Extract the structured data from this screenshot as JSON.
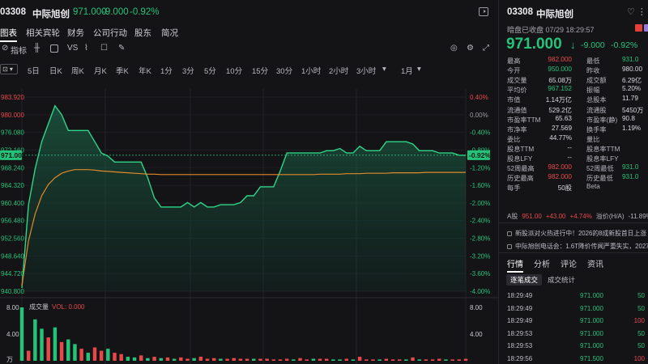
{
  "header": {
    "code": "03308",
    "name": "中际旭创",
    "price": "971.000",
    "change": "-9.000",
    "pct": "-0.92%"
  },
  "tabs": [
    "图表",
    "相关宾轮",
    "财务",
    "公司行动",
    "股东",
    "简况"
  ],
  "toolbar": {
    "indicator_label": "指标",
    "vs_label": "VS"
  },
  "periods": [
    "5日",
    "日K",
    "周K",
    "月K",
    "季K",
    "年K",
    "1分",
    "3分",
    "5分",
    "10分",
    "15分",
    "30分",
    "1小时",
    "2小时",
    "3小时",
    "1月"
  ],
  "chart_data": {
    "type": "line",
    "title": "",
    "price_axis": [
      "983.920",
      "980.000",
      "976.080",
      "972.160",
      "968.240",
      "964.320",
      "960.400",
      "956.480",
      "952.560",
      "948.640",
      "944.720",
      "940.800"
    ],
    "pct_axis": [
      "0.40%",
      "0.00%",
      "-0.40%",
      "-0.80%",
      "-1.20%",
      "-1.60%",
      "-2.00%",
      "-2.40%",
      "-2.80%",
      "-3.20%",
      "-3.60%",
      "-4.00%"
    ],
    "last_price_tag": "971.000",
    "last_pct_tag": "-0.92%",
    "price_series": [
      941.5,
      960,
      968,
      974,
      978,
      982,
      980,
      976.5,
      976.5,
      976.5,
      976.5,
      974,
      971.5,
      970.8,
      969.5,
      969.5,
      969.5,
      969.5,
      969.5,
      966,
      961.5,
      959.5,
      959.5,
      959.5,
      959.5,
      960.5,
      959.5,
      960.5,
      959.5,
      959.5,
      960,
      960,
      960,
      960.5,
      962,
      962,
      964,
      964,
      964,
      967.5,
      971.5,
      971.5,
      971.5,
      971.5,
      971.5,
      971.5,
      972,
      972,
      972.5,
      971.5,
      971.5,
      973,
      972,
      972,
      972,
      974,
      974,
      974,
      974,
      973.5,
      972,
      972,
      972,
      971.5,
      971.5,
      971.5,
      971,
      971
    ],
    "avg_series": [
      942,
      952,
      958,
      962,
      964.5,
      966,
      967,
      967.5,
      967.8,
      967.8,
      967.8,
      967.7,
      967.5,
      967.4,
      967.3,
      967.2,
      967.1,
      967,
      966.9,
      966.8,
      966.8,
      966.7,
      966.7,
      966.7,
      966.7,
      966.7,
      966.7,
      966.7,
      966.7,
      966.7,
      966.7,
      966.7,
      966.7,
      966.7,
      966.7,
      966.7,
      966.7,
      966.7,
      966.7,
      966.7,
      966.7,
      966.7,
      966.7,
      966.7,
      966.7,
      966.8,
      966.8,
      966.8,
      966.8,
      966.9,
      966.9,
      966.9,
      967,
      967,
      967,
      967,
      967.1,
      967.1,
      967.1,
      967.1,
      967.1,
      967.2,
      967.2,
      967.2,
      967.2,
      967.2,
      967.2,
      967.2
    ],
    "ylim": [
      940.8,
      983.92
    ],
    "volume_label": "成交量",
    "vol_value_label": "VOL: 0.000",
    "vol_axis_left": [
      "8.00",
      "4.00",
      "万"
    ],
    "vol_axis_right": [
      "8.00",
      "4.00"
    ],
    "volume": [
      8.0,
      1.5,
      6.2,
      4.8,
      3.5,
      5.0,
      2.8,
      3.2,
      2.5,
      1.8,
      1.2,
      2.0,
      1.5,
      1.8,
      1.2,
      1.0,
      0.6,
      0.5,
      0.8,
      0.4,
      0.6,
      0.4,
      0.5,
      0.3,
      0.5,
      0.3,
      0.4,
      0.6,
      0.3,
      0.4,
      0.3,
      0.3,
      0.4,
      0.3,
      0.3,
      0.3,
      0.3,
      0.3,
      0.2,
      0.2,
      0.3,
      0.2,
      0.4,
      0.2,
      0.3,
      0.3,
      0.3,
      0.2,
      0.2,
      0.3,
      0.2,
      0.6,
      0.2,
      0.2,
      0.2,
      0.3,
      0.2,
      0.2,
      0.2,
      0.5,
      0.2,
      0.2,
      0.2,
      0.3,
      0.2,
      0.2,
      0.2,
      0.3
    ],
    "volume_up": [
      false,
      true,
      false,
      false,
      true,
      false,
      true,
      false,
      false,
      true,
      false,
      true,
      true,
      false,
      true,
      true,
      false,
      false,
      true,
      false,
      true,
      false,
      true,
      false,
      true,
      true,
      false,
      true,
      true,
      true,
      false,
      true,
      true,
      true,
      true,
      false,
      true,
      true,
      true,
      true,
      true,
      false,
      true,
      true,
      false,
      true,
      true,
      false,
      false,
      true,
      false,
      true,
      true,
      true,
      false,
      true,
      true,
      true,
      false,
      true,
      false,
      true,
      true,
      true,
      false,
      true,
      true,
      true
    ]
  },
  "quote": {
    "code": "03308",
    "name": "中际旭创",
    "status": "暗盘已收盘 07/29 18:29:57",
    "price": "971.000",
    "change": "-9.000",
    "pct": "-0.92%",
    "rows": [
      [
        "最高",
        "982.000",
        "最低",
        "931.0"
      ],
      [
        "今开",
        "950.000",
        "昨收",
        "980.00"
      ],
      [
        "成交量",
        "65.08万",
        "成交额",
        "6.29亿"
      ],
      [
        "平均价",
        "967.152",
        "振幅",
        "5.20%"
      ],
      [
        "市值",
        "1.14万亿",
        "总股本",
        "11.79"
      ],
      [
        "流通值",
        "529.2亿",
        "流通股",
        "5450万"
      ],
      [
        "市盈率TTM",
        "65.63",
        "市盈率(静)",
        "90.8"
      ],
      [
        "市净率",
        "27.569",
        "换手率",
        "1.19%"
      ],
      [
        "委比",
        "44.77%",
        "量比",
        ""
      ],
      [
        "股息TTM",
        "--",
        "股息率TTM",
        ""
      ],
      [
        "股息LFY",
        "--",
        "股息率LFY",
        ""
      ],
      [
        "52周最高",
        "982.000",
        "52周最低",
        "931.0"
      ],
      [
        "历史最高",
        "982.000",
        "历史最低",
        "931.0"
      ],
      [
        "每手",
        "50股",
        "Beta",
        ""
      ]
    ],
    "a_share": [
      "A股",
      "951.00",
      "+43.00",
      "+4.74%",
      "溢价(H/A)",
      "-11.89%"
    ],
    "news": [
      "新股派对火热进行中！2026的8成新股首日上涨",
      "中际旭创电话会：1.6T降价传闻严重失实，2027..."
    ],
    "tabs": [
      "行情",
      "分析",
      "评论",
      "资讯"
    ],
    "subtabs": [
      "逐笔成交",
      "成交统计"
    ],
    "trades": [
      [
        "18:29:49",
        "971.000",
        "50"
      ],
      [
        "18:29:49",
        "971.000",
        "50"
      ],
      [
        "18:29:49",
        "971.000",
        "100"
      ],
      [
        "18:29:53",
        "971.000",
        "50"
      ],
      [
        "18:29:53",
        "971.000",
        "50"
      ],
      [
        "18:29:56",
        "971.500",
        "100"
      ]
    ]
  }
}
